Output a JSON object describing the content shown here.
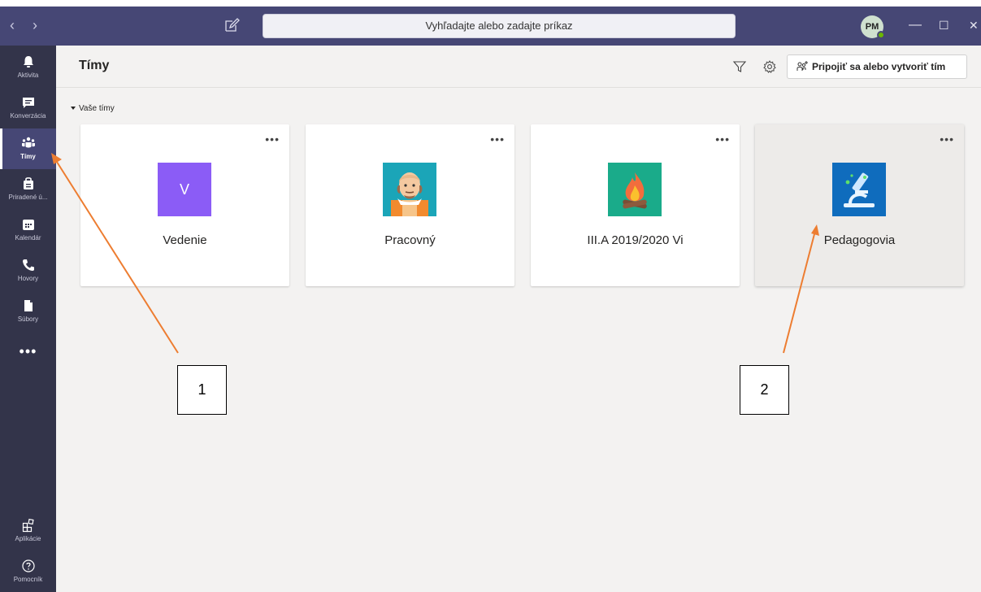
{
  "titlebar": {
    "back_glyph": "‹",
    "forward_glyph": "›",
    "compose_icon": "compose-icon",
    "search_placeholder": "Vyhľadajte alebo zadajte príkaz",
    "avatar_initials": "PM",
    "minimize_glyph": "—",
    "maximize_glyph": "☐",
    "close_glyph": "✕"
  },
  "rail": {
    "items": [
      {
        "label": "Aktivita",
        "icon": "bell-icon"
      },
      {
        "label": "Konverzácia",
        "icon": "chat-icon"
      },
      {
        "label": "Tímy",
        "icon": "teams-icon",
        "active": true
      },
      {
        "label": "Priradené ú...",
        "icon": "assignments-icon"
      },
      {
        "label": "Kalendár",
        "icon": "calendar-icon"
      },
      {
        "label": "Hovory",
        "icon": "phone-icon"
      },
      {
        "label": "Súbory",
        "icon": "files-icon"
      }
    ],
    "more_glyph": "•••",
    "bottom": [
      {
        "label": "Aplikácie",
        "icon": "apps-icon"
      },
      {
        "label": "Pomocník",
        "icon": "help-icon"
      }
    ]
  },
  "header": {
    "title": "Tímy",
    "filter_icon": "filter-icon",
    "settings_icon": "gear-icon",
    "join_button": "Pripojiť sa alebo vytvoriť tím"
  },
  "section": {
    "label": "Vaše tímy"
  },
  "teams": [
    {
      "name": "Vedenie",
      "logo_letter": "V",
      "logo_color": "#8b5cf6"
    },
    {
      "name": "Pracovný",
      "logo_color": "#1ba5b8"
    },
    {
      "name": "III.A 2019/2020 Vi",
      "logo_color": "#1aab8a"
    },
    {
      "name": "Pedagogovia",
      "logo_color": "#0f6cbd",
      "hovered": true
    }
  ],
  "card_more_glyph": "•••",
  "annotations": {
    "callout_1": "1",
    "callout_2": "2",
    "arrow_color": "#ed7d31"
  },
  "colors": {
    "titlebar": "#464775",
    "rail": "#33344a",
    "background": "#f3f2f1"
  }
}
